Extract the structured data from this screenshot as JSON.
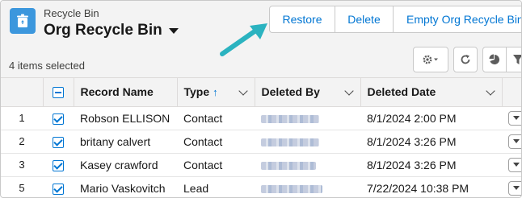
{
  "header": {
    "breadcrumb": "Recycle Bin",
    "title": "Org Recycle Bin",
    "selected_count": "4 items selected",
    "icon": "recycle-bin-icon"
  },
  "actions": {
    "restore": "Restore",
    "delete": "Delete",
    "empty": "Empty Org Recycle Bin"
  },
  "toolbar": {
    "icons": [
      "gear-icon",
      "refresh-icon",
      "chart-icon",
      "filter-icon"
    ]
  },
  "table": {
    "columns": {
      "record_name": "Record Name",
      "type": "Type",
      "deleted_by": "Deleted By",
      "deleted_date": "Deleted Date"
    },
    "type_sort_icon": "↑",
    "rows": [
      {
        "num": "1",
        "checked": true,
        "record_name": "Robson ELLISON",
        "type": "Contact",
        "deleted_date": "8/1/2024 2:00 PM"
      },
      {
        "num": "2",
        "checked": true,
        "record_name": "britany calvert",
        "type": "Contact",
        "deleted_date": "8/1/2024 3:26 PM"
      },
      {
        "num": "3",
        "checked": true,
        "record_name": "Kasey crawford",
        "type": "Contact",
        "deleted_date": "8/1/2024 3:26 PM"
      },
      {
        "num": "5",
        "checked": true,
        "record_name": "Mario Vaskovitch",
        "type": "Lead",
        "deleted_date": "7/22/2024 10:38 PM"
      }
    ]
  },
  "colors": {
    "accent": "#0176d3",
    "annotation_arrow": "#2bb3c0",
    "app_icon_bg": "#3c97dd"
  }
}
